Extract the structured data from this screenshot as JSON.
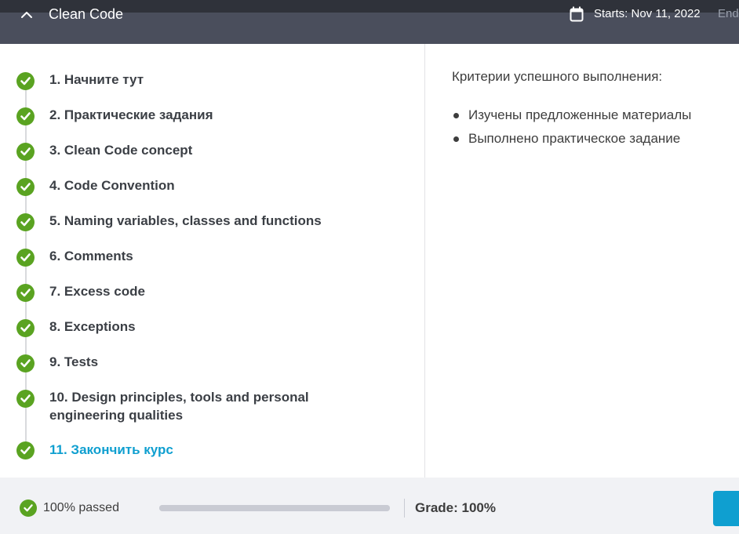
{
  "header": {
    "course_title": "Clean Code",
    "starts": "Starts: Nov 11, 2022",
    "ends_partial": "End"
  },
  "steps": [
    {
      "label": "1. Начните тут",
      "completed": true,
      "active": false
    },
    {
      "label": "2. Практические задания",
      "completed": true,
      "active": false
    },
    {
      "label": "3. Clean Code concept",
      "completed": true,
      "active": false
    },
    {
      "label": "4. Code Convention",
      "completed": true,
      "active": false
    },
    {
      "label": "5. Naming variables, classes and functions",
      "completed": true,
      "active": false
    },
    {
      "label": "6. Comments",
      "completed": true,
      "active": false
    },
    {
      "label": "7. Excess code",
      "completed": true,
      "active": false
    },
    {
      "label": "8. Exceptions",
      "completed": true,
      "active": false
    },
    {
      "label": "9. Tests",
      "completed": true,
      "active": false
    },
    {
      "label": "10. Design principles, tools and personal engineering qualities",
      "completed": true,
      "active": false
    },
    {
      "label": "11. Закончить курс",
      "completed": true,
      "active": true
    }
  ],
  "criteria": {
    "title": "Критерии успешного выполнения:",
    "items": [
      "Изучены предложенные материалы",
      "Выполнено практическое задание"
    ]
  },
  "footer": {
    "passed": "100% passed",
    "progress": 1.0,
    "grade": "Grade: 100%"
  },
  "colors": {
    "header_bg": "#4a4e5c",
    "check_green": "#5aa321",
    "active_blue": "#0f9fd0",
    "footer_bg": "#f1f2f5"
  },
  "icons": {
    "collapse": "chevron-up-icon",
    "calendar": "calendar-icon",
    "step_status": "check-circle-icon"
  }
}
